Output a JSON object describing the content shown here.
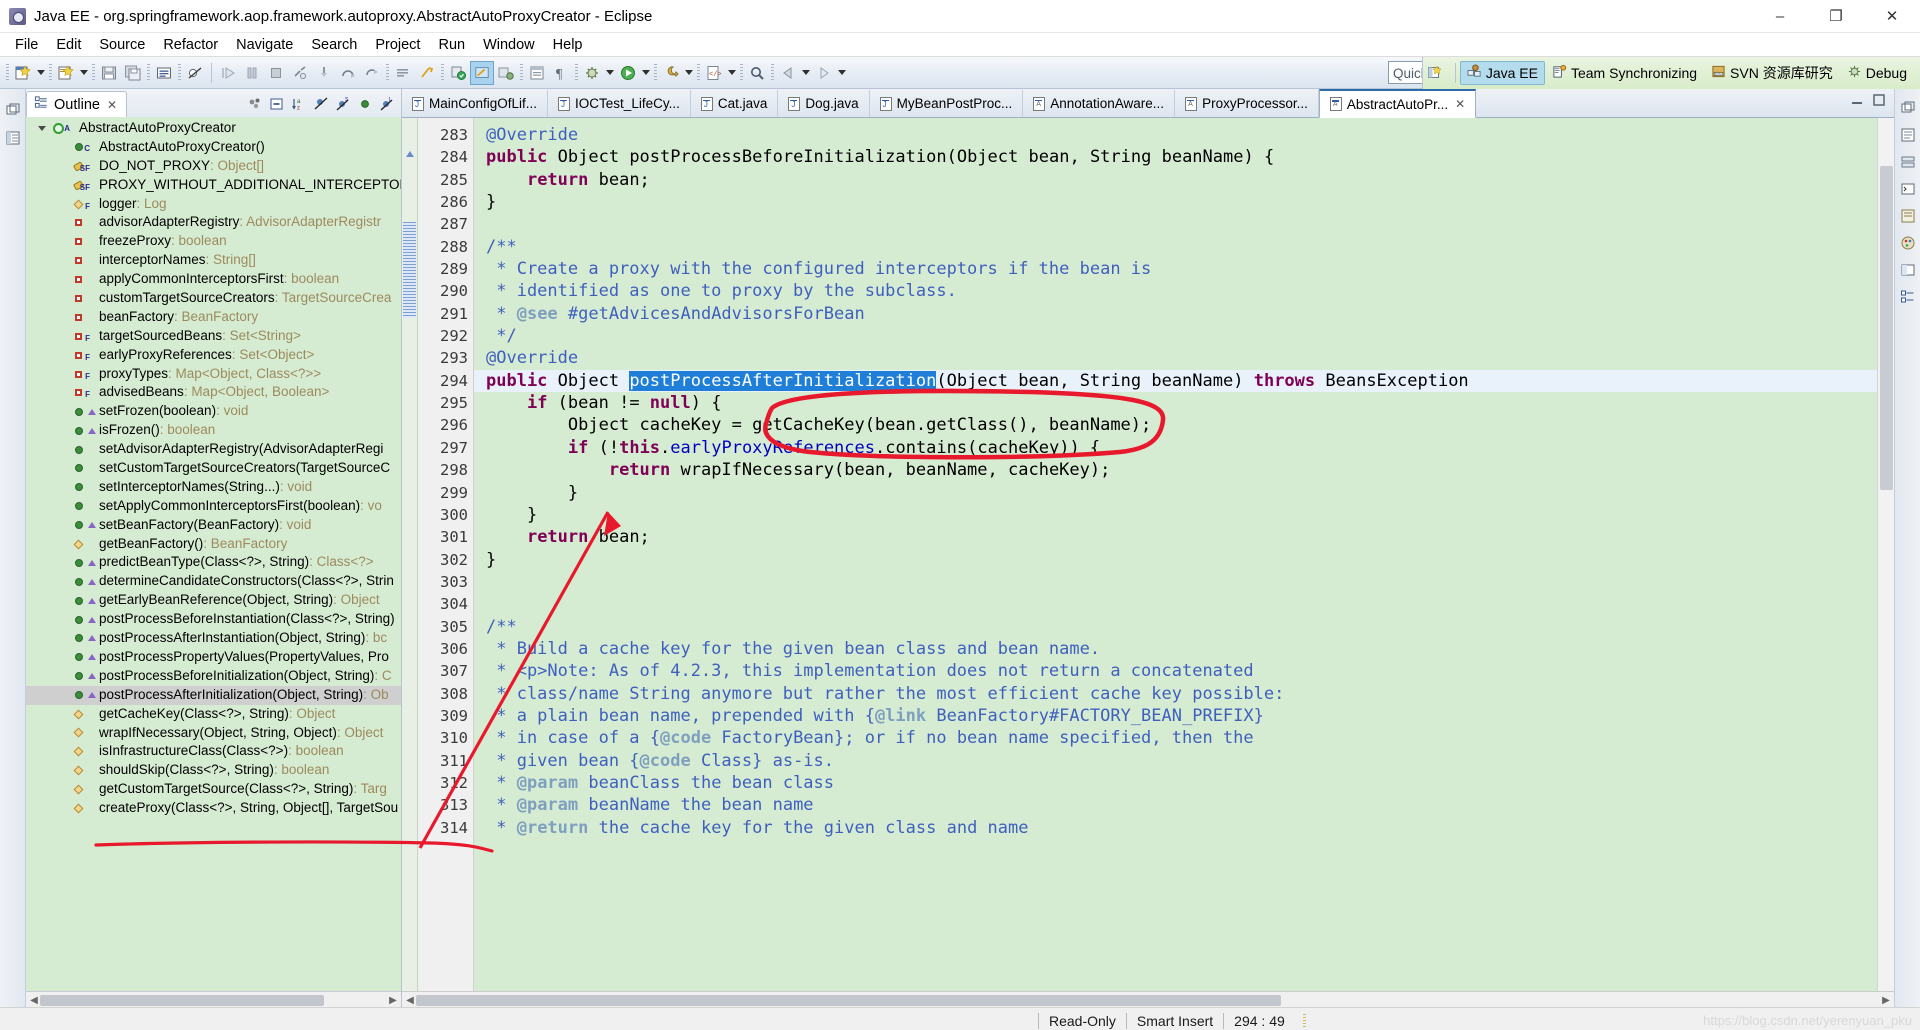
{
  "window": {
    "title": "Java EE - org.springframework.aop.framework.autoproxy.AbstractAutoProxyCreator - Eclipse",
    "app_icon": "eclipse-icon",
    "minimize": "–",
    "maximize": "❐",
    "close": "✕"
  },
  "menu": [
    "File",
    "Edit",
    "Source",
    "Refactor",
    "Navigate",
    "Search",
    "Project",
    "Run",
    "Window",
    "Help"
  ],
  "toolbar": {
    "quick_access_placeholder": "Quick Access",
    "perspectives": [
      {
        "label": "Java EE",
        "icon": "javaee-perspective-icon",
        "active": true
      },
      {
        "label": "Team Synchronizing",
        "icon": "team-sync-icon",
        "active": false
      },
      {
        "label": "SVN 资源库研究",
        "icon": "svn-icon",
        "active": false
      },
      {
        "label": "Debug",
        "icon": "debug-icon",
        "active": false
      }
    ],
    "open_perspective": "open-perspective-icon"
  },
  "outline": {
    "tab_label": "Outline",
    "close_glyph": "✕",
    "tools": [
      "focus-icon",
      "collapse-all-icon",
      "sort-icon",
      "hide-fields-icon",
      "hide-static-icon",
      "hide-nonpublic-icon",
      "hide-local-icon"
    ],
    "items": [
      {
        "indent": 0,
        "twisty": true,
        "icon": "class-icon",
        "sup": "A",
        "name": "AbstractAutoProxyCreator",
        "type": ""
      },
      {
        "indent": 1,
        "twisty": false,
        "icon": "method-green-icon",
        "sup": "C",
        "name": "AbstractAutoProxyCreator()",
        "type": ""
      },
      {
        "indent": 1,
        "twisty": false,
        "icon": "field-key-icon",
        "sup": "SF",
        "name": "DO_NOT_PROXY",
        "type": " : Object[]"
      },
      {
        "indent": 1,
        "twisty": false,
        "icon": "field-key-icon",
        "sup": "SF",
        "name": "PROXY_WITHOUT_ADDITIONAL_INTERCEPTORS",
        "type": " :"
      },
      {
        "indent": 1,
        "twisty": false,
        "icon": "field-diamond-icon",
        "sup": "F",
        "name": "logger",
        "type": " : Log"
      },
      {
        "indent": 1,
        "twisty": false,
        "icon": "field-private-icon",
        "sup": "",
        "name": "advisorAdapterRegistry",
        "type": " : AdvisorAdapterRegistr"
      },
      {
        "indent": 1,
        "twisty": false,
        "icon": "field-private-icon",
        "sup": "",
        "name": "freezeProxy",
        "type": " : boolean"
      },
      {
        "indent": 1,
        "twisty": false,
        "icon": "field-private-icon",
        "sup": "",
        "name": "interceptorNames",
        "type": " : String[]"
      },
      {
        "indent": 1,
        "twisty": false,
        "icon": "field-private-icon",
        "sup": "",
        "name": "applyCommonInterceptorsFirst",
        "type": " : boolean"
      },
      {
        "indent": 1,
        "twisty": false,
        "icon": "field-private-icon",
        "sup": "",
        "name": "customTargetSourceCreators",
        "type": " : TargetSourceCrea"
      },
      {
        "indent": 1,
        "twisty": false,
        "icon": "field-private-icon",
        "sup": "",
        "name": "beanFactory",
        "type": " : BeanFactory"
      },
      {
        "indent": 1,
        "twisty": false,
        "icon": "field-private-icon",
        "sup": "F",
        "name": "targetSourcedBeans",
        "type": " : Set<String>"
      },
      {
        "indent": 1,
        "twisty": false,
        "icon": "field-private-icon",
        "sup": "F",
        "name": "earlyProxyReferences",
        "type": " : Set<Object>"
      },
      {
        "indent": 1,
        "twisty": false,
        "icon": "field-private-icon",
        "sup": "F",
        "name": "proxyTypes",
        "type": " : Map<Object, Class<?>>"
      },
      {
        "indent": 1,
        "twisty": false,
        "icon": "field-private-icon",
        "sup": "F",
        "name": "advisedBeans",
        "type": " : Map<Object, Boolean>"
      },
      {
        "indent": 1,
        "twisty": false,
        "icon": "method-green-icon",
        "sup": "",
        "override": true,
        "name": "setFrozen(boolean)",
        "type": " : void"
      },
      {
        "indent": 1,
        "twisty": false,
        "icon": "method-green-icon",
        "sup": "",
        "override": true,
        "name": "isFrozen()",
        "type": " : boolean"
      },
      {
        "indent": 1,
        "twisty": false,
        "icon": "method-green-icon",
        "sup": "",
        "name": "setAdvisorAdapterRegistry(AdvisorAdapterRegi",
        "type": ""
      },
      {
        "indent": 1,
        "twisty": false,
        "icon": "method-green-icon",
        "sup": "",
        "name": "setCustomTargetSourceCreators(TargetSourceC",
        "type": ""
      },
      {
        "indent": 1,
        "twisty": false,
        "icon": "method-green-icon",
        "sup": "",
        "name": "setInterceptorNames(String...)",
        "type": " : void"
      },
      {
        "indent": 1,
        "twisty": false,
        "icon": "method-green-icon",
        "sup": "",
        "name": "setApplyCommonInterceptorsFirst(boolean)",
        "type": " : vo"
      },
      {
        "indent": 1,
        "twisty": false,
        "icon": "method-green-icon",
        "sup": "",
        "override": true,
        "name": "setBeanFactory(BeanFactory)",
        "type": " : void"
      },
      {
        "indent": 1,
        "twisty": false,
        "icon": "method-orange-icon",
        "sup": "",
        "name": "getBeanFactory()",
        "type": " : BeanFactory"
      },
      {
        "indent": 1,
        "twisty": false,
        "icon": "method-green-icon",
        "sup": "",
        "override": true,
        "name": "predictBeanType(Class<?>, String)",
        "type": " : Class<?>"
      },
      {
        "indent": 1,
        "twisty": false,
        "icon": "method-green-icon",
        "sup": "",
        "override": true,
        "name": "determineCandidateConstructors(Class<?>, Strin",
        "type": ""
      },
      {
        "indent": 1,
        "twisty": false,
        "icon": "method-green-icon",
        "sup": "",
        "override": true,
        "name": "getEarlyBeanReference(Object, String)",
        "type": " : Object"
      },
      {
        "indent": 1,
        "twisty": false,
        "icon": "method-green-icon",
        "sup": "",
        "override": true,
        "name": "postProcessBeforeInstantiation(Class<?>, String)",
        "type": ""
      },
      {
        "indent": 1,
        "twisty": false,
        "icon": "method-green-icon",
        "sup": "",
        "override": true,
        "name": "postProcessAfterInstantiation(Object, String)",
        "type": " : bc"
      },
      {
        "indent": 1,
        "twisty": false,
        "icon": "method-green-icon",
        "sup": "",
        "override": true,
        "name": "postProcessPropertyValues(PropertyValues, Pro",
        "type": ""
      },
      {
        "indent": 1,
        "twisty": false,
        "icon": "method-green-icon",
        "sup": "",
        "override": true,
        "name": "postProcessBeforeInitialization(Object, String)",
        "type": " : C"
      },
      {
        "indent": 1,
        "twisty": false,
        "icon": "method-green-icon",
        "sup": "",
        "override": true,
        "selected": true,
        "name": "postProcessAfterInitialization(Object, String)",
        "type": " : Ob"
      },
      {
        "indent": 1,
        "twisty": false,
        "icon": "method-orange-icon",
        "sup": "",
        "name": "getCacheKey(Class<?>, String)",
        "type": " : Object"
      },
      {
        "indent": 1,
        "twisty": false,
        "icon": "method-orange-icon",
        "sup": "",
        "name": "wrapIfNecessary(Object, String, Object)",
        "type": " : Object"
      },
      {
        "indent": 1,
        "twisty": false,
        "icon": "method-orange-icon",
        "sup": "",
        "name": "isInfrastructureClass(Class<?>)",
        "type": " : boolean"
      },
      {
        "indent": 1,
        "twisty": false,
        "icon": "method-orange-icon",
        "sup": "",
        "name": "shouldSkip(Class<?>, String)",
        "type": " : boolean"
      },
      {
        "indent": 1,
        "twisty": false,
        "icon": "method-orange-icon",
        "sup": "",
        "name": "getCustomTargetSource(Class<?>, String)",
        "type": " : Targ"
      },
      {
        "indent": 1,
        "twisty": false,
        "icon": "method-orange-icon",
        "sup": "",
        "name": "createProxy(Class<?>, String, Object[], TargetSou",
        "type": ""
      }
    ]
  },
  "editor": {
    "tabs": [
      {
        "label": "MainConfigOfLif...",
        "icon": "java-file-icon",
        "active": false
      },
      {
        "label": "IOCTest_LifeCy...",
        "icon": "java-file-icon",
        "active": false
      },
      {
        "label": "Cat.java",
        "icon": "java-file-icon",
        "active": false
      },
      {
        "label": "Dog.java",
        "icon": "java-file-icon",
        "active": false
      },
      {
        "label": "MyBeanPostProc...",
        "icon": "java-file-icon",
        "active": false
      },
      {
        "label": "AnnotationAware...",
        "icon": "class-file-icon",
        "active": false
      },
      {
        "label": "ProxyProcessor...",
        "icon": "class-file-icon",
        "active": false
      },
      {
        "label": "AbstractAutoPr...",
        "icon": "class-file-icon",
        "active": true,
        "close": "✕"
      }
    ],
    "first_line": 283,
    "lines": [
      {
        "n": 283,
        "fold": true,
        "tokens": [
          {
            "t": "@Override",
            "c": "cm"
          }
        ]
      },
      {
        "n": 284,
        "marker": "override",
        "tokens": [
          {
            "t": "public ",
            "c": "kw"
          },
          {
            "t": "Object ",
            "c": "plain"
          },
          {
            "t": "postProcessBeforeInitialization",
            "c": "plain"
          },
          {
            "t": "(",
            "c": "plain"
          },
          {
            "t": "Object ",
            "c": "plain"
          },
          {
            "t": "bean",
            "c": "plain"
          },
          {
            "t": ", ",
            "c": "plain"
          },
          {
            "t": "String ",
            "c": "plain"
          },
          {
            "t": "beanName",
            "c": "plain"
          },
          {
            "t": ") {",
            "c": "plain"
          }
        ]
      },
      {
        "n": 285,
        "tokens": [
          {
            "t": "    ",
            "c": "plain"
          },
          {
            "t": "return ",
            "c": "kw"
          },
          {
            "t": "bean;",
            "c": "plain"
          }
        ]
      },
      {
        "n": 286,
        "tokens": [
          {
            "t": "}",
            "c": "plain"
          }
        ]
      },
      {
        "n": 287,
        "tokens": []
      },
      {
        "n": 288,
        "fold": true,
        "tokens": [
          {
            "t": "/**",
            "c": "jd"
          }
        ]
      },
      {
        "n": 289,
        "tokens": [
          {
            "t": " * Create a proxy with the configured interceptors if the bean is",
            "c": "jd"
          }
        ]
      },
      {
        "n": 290,
        "tokens": [
          {
            "t": " * identified as one to proxy by the subclass.",
            "c": "jd"
          }
        ]
      },
      {
        "n": 291,
        "tokens": [
          {
            "t": " * ",
            "c": "jd"
          },
          {
            "t": "@see",
            "c": "jdtag"
          },
          {
            "t": " #getAdvicesAndAdvisorsForBean",
            "c": "jdlink"
          }
        ]
      },
      {
        "n": 292,
        "tokens": [
          {
            "t": " */",
            "c": "jd"
          }
        ]
      },
      {
        "n": 293,
        "tokens": [
          {
            "t": "@Override",
            "c": "cm"
          }
        ]
      },
      {
        "n": 294,
        "cursor": true,
        "marker": "override",
        "tokens": [
          {
            "t": "public ",
            "c": "kw"
          },
          {
            "t": "Object ",
            "c": "plain"
          },
          {
            "t": "postProcessAfterInitialization",
            "c": "sel-tok"
          },
          {
            "t": "(Object ",
            "c": "plain"
          },
          {
            "t": "bean",
            "c": "plain"
          },
          {
            "t": ", ",
            "c": "plain"
          },
          {
            "t": "String ",
            "c": "plain"
          },
          {
            "t": "beanName",
            "c": "plain"
          },
          {
            "t": ") ",
            "c": "plain"
          },
          {
            "t": "throws ",
            "c": "kw"
          },
          {
            "t": "BeansException",
            "c": "plain"
          }
        ]
      },
      {
        "n": 295,
        "tokens": [
          {
            "t": "    ",
            "c": "plain"
          },
          {
            "t": "if ",
            "c": "kw"
          },
          {
            "t": "(bean != ",
            "c": "plain"
          },
          {
            "t": "null",
            "c": "kw"
          },
          {
            "t": ") {",
            "c": "plain"
          }
        ]
      },
      {
        "n": 296,
        "tokens": [
          {
            "t": "        Object cacheKey = getCacheKey(bean.getClass(), beanName);",
            "c": "plain"
          }
        ]
      },
      {
        "n": 297,
        "tokens": [
          {
            "t": "        ",
            "c": "plain"
          },
          {
            "t": "if ",
            "c": "kw"
          },
          {
            "t": "(!",
            "c": "plain"
          },
          {
            "t": "this",
            "c": "kw"
          },
          {
            "t": ".",
            "c": "plain"
          },
          {
            "t": "earlyProxyReferences",
            "c": "fld"
          },
          {
            "t": ".contains(cacheKey)) {",
            "c": "plain"
          }
        ]
      },
      {
        "n": 298,
        "tokens": [
          {
            "t": "            ",
            "c": "plain"
          },
          {
            "t": "return ",
            "c": "kw"
          },
          {
            "t": "wrapIfNecessary(bean, beanName, cacheKey);",
            "c": "plain"
          }
        ]
      },
      {
        "n": 299,
        "tokens": [
          {
            "t": "        }",
            "c": "plain"
          }
        ]
      },
      {
        "n": 300,
        "tokens": [
          {
            "t": "    }",
            "c": "plain"
          }
        ]
      },
      {
        "n": 301,
        "tokens": [
          {
            "t": "    ",
            "c": "plain"
          },
          {
            "t": "return ",
            "c": "kw"
          },
          {
            "t": "bean;",
            "c": "plain"
          }
        ]
      },
      {
        "n": 302,
        "tokens": [
          {
            "t": "}",
            "c": "plain"
          }
        ]
      },
      {
        "n": 303,
        "tokens": []
      },
      {
        "n": 304,
        "tokens": []
      },
      {
        "n": 305,
        "fold": true,
        "tokens": [
          {
            "t": "/**",
            "c": "jd"
          }
        ]
      },
      {
        "n": 306,
        "tokens": [
          {
            "t": " * Build a cache key for the given bean class and bean name.",
            "c": "jd"
          }
        ]
      },
      {
        "n": 307,
        "tokens": [
          {
            "t": " * <p>Note: As of 4.2.3, this implementation does not return a concatenated",
            "c": "jd"
          }
        ]
      },
      {
        "n": 308,
        "tokens": [
          {
            "t": " * class/name String anymore but rather the most efficient cache key possible:",
            "c": "jd"
          }
        ]
      },
      {
        "n": 309,
        "tokens": [
          {
            "t": " * a plain bean name, prepended with {",
            "c": "jd"
          },
          {
            "t": "@link",
            "c": "jdtag"
          },
          {
            "t": " BeanFactory#FACTORY_BEAN_PREFIX}",
            "c": "jdlink"
          }
        ]
      },
      {
        "n": 310,
        "tokens": [
          {
            "t": " * in case of a {",
            "c": "jd"
          },
          {
            "t": "@code",
            "c": "jdtag"
          },
          {
            "t": " FactoryBean}; or if no bean name specified, then the",
            "c": "jd"
          }
        ]
      },
      {
        "n": 311,
        "tokens": [
          {
            "t": " * given bean {",
            "c": "jd"
          },
          {
            "t": "@code",
            "c": "jdtag"
          },
          {
            "t": " Class} as-is.",
            "c": "jd"
          }
        ]
      },
      {
        "n": 312,
        "tokens": [
          {
            "t": " * ",
            "c": "jd"
          },
          {
            "t": "@param",
            "c": "jdtag"
          },
          {
            "t": " beanClass the bean class",
            "c": "jd"
          }
        ]
      },
      {
        "n": 313,
        "tokens": [
          {
            "t": " * ",
            "c": "jd"
          },
          {
            "t": "@param",
            "c": "jdtag"
          },
          {
            "t": " beanName the bean name",
            "c": "jd"
          }
        ]
      },
      {
        "n": 314,
        "tokens": [
          {
            "t": " * ",
            "c": "jd"
          },
          {
            "t": "@return",
            "c": "jdtag"
          },
          {
            "t": " the cache key for the given class and name",
            "c": "jd"
          }
        ]
      }
    ]
  },
  "statusbar": {
    "read_only": "Read-Only",
    "insert_mode": "Smart Insert",
    "position": "294 : 49",
    "watermark": "https://blog.csdn.net/yerenyuan_pku"
  },
  "annotations": {
    "highlight_color": "#e8192c",
    "circle_target": "postProcessAfterInitialization",
    "arrow_from": "outline-item-postProcessAfterInitialization",
    "arrow_to": "code-line-297"
  }
}
